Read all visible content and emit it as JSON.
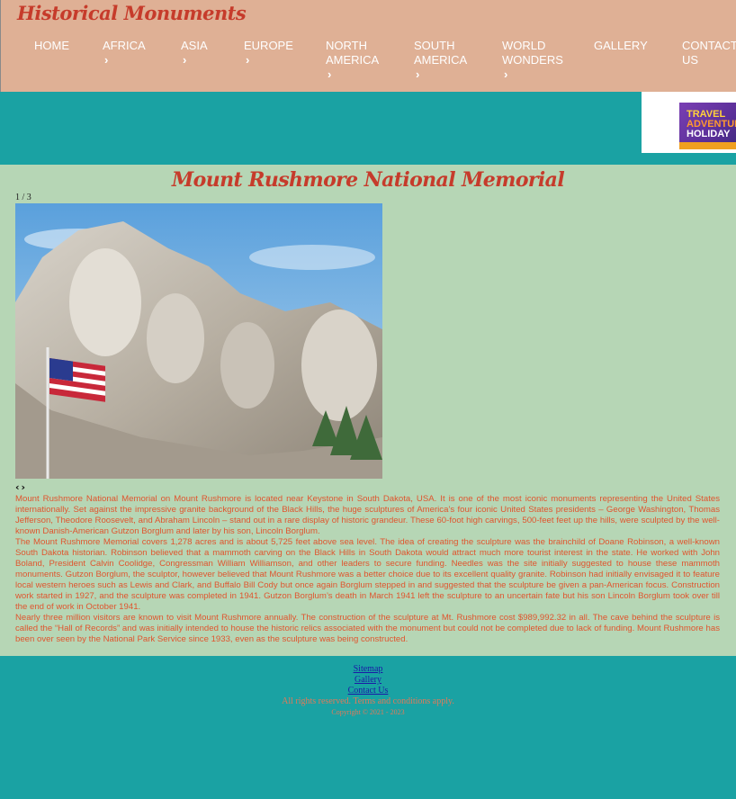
{
  "header": {
    "site_title": "Historical Monuments",
    "nav": [
      {
        "label": "HOME"
      },
      {
        "label": "AFRICA",
        "has_submenu": true
      },
      {
        "label": "ASIA",
        "has_submenu": true
      },
      {
        "label": "EUROPE",
        "has_submenu": true
      },
      {
        "label": "NORTH AMERICA",
        "line1": "NORTH",
        "line2": "AMERICA",
        "has_submenu": true
      },
      {
        "label": "SOUTH AMERICA",
        "line1": "SOUTH",
        "line2": "AMERICA",
        "has_submenu": true
      },
      {
        "label": "WORLD WONDERS",
        "line1": "WORLD",
        "line2": "WONDERS",
        "has_submenu": true
      },
      {
        "label": "GALLERY"
      },
      {
        "label": "CONTACT US",
        "line1": "CONTACT",
        "line2": "US"
      }
    ],
    "chevron": "›"
  },
  "ad": {
    "line1": "TRAVEL",
    "line2": "ADVENTURE",
    "line3": "HOLIDAY"
  },
  "main": {
    "title": "Mount Rushmore National Memorial",
    "slide_counter": "1 / 3",
    "prev_label": "‹",
    "next_label": "›",
    "paragraphs": [
      "Mount Rushmore National Memorial on Mount Rushmore is located near Keystone in South Dakota, USA. It is one of the most iconic monuments representing the United States internationally. Set against the impressive granite background of the Black Hills, the huge sculptures of America’s four iconic United States presidents – George Washington, Thomas Jefferson, Theodore Roosevelt, and Abraham Lincoln – stand out in a rare display of historic grandeur. These 60-foot high carvings, 500-feet feet up the hills, were sculpted by the well-known Danish-American Gutzon Borglum and later by his son, Lincoln Borglum.",
      "The Mount Rushmore Memorial covers 1,278 acres and is about 5,725 feet above sea level. The idea of creating the sculpture was the brainchild of Doane Robinson, a well-known South Dakota historian. Robinson believed that a mammoth carving on the Black Hills in South Dakota would attract much more tourist interest in the state. He worked with John Boland, President Calvin Coolidge, Congressman William Williamson, and other leaders to secure funding. Needles was the site initially suggested to house these mammoth monuments. Gutzon Borglum, the sculptor, however believed that Mount Rushmore was a better choice due to its excellent quality granite. Robinson had initially envisaged it to feature local western heroes such as Lewis and Clark, and Buffalo Bill Cody but once again Borglum stepped in and suggested that the sculpture be given a pan-American focus. Construction work started in 1927, and the sculpture was completed in 1941. Gutzon Borglum’s death in March 1941 left the sculpture to an uncertain fate but his son Lincoln Borglum took over till the end of work in October 1941.",
      "Nearly three million visitors are known to visit Mount Rushmore annually. The construction of the sculpture at Mt. Rushmore cost $989,992.32 in all. The cave behind the sculpture is called the “Hall of Records” and was initially intended to house the historic relics associated with the monument but could not be completed due to lack of funding. Mount Rushmore has been over seen by the National Park Service since 1933, even as the sculpture was being constructed."
    ]
  },
  "footer": {
    "links": [
      "Sitemap",
      "Gallery",
      "Contact Us"
    ],
    "rights": "All rights reserved. Terms and conditions apply.",
    "copyright": "Copyright © 2021 - 2023"
  },
  "colors": {
    "header_bg": "#dfb095",
    "title_red": "#c63b2b",
    "content_bg": "#b6d6b5",
    "teal": "#1aa2a3",
    "body_text": "#e0552e"
  }
}
